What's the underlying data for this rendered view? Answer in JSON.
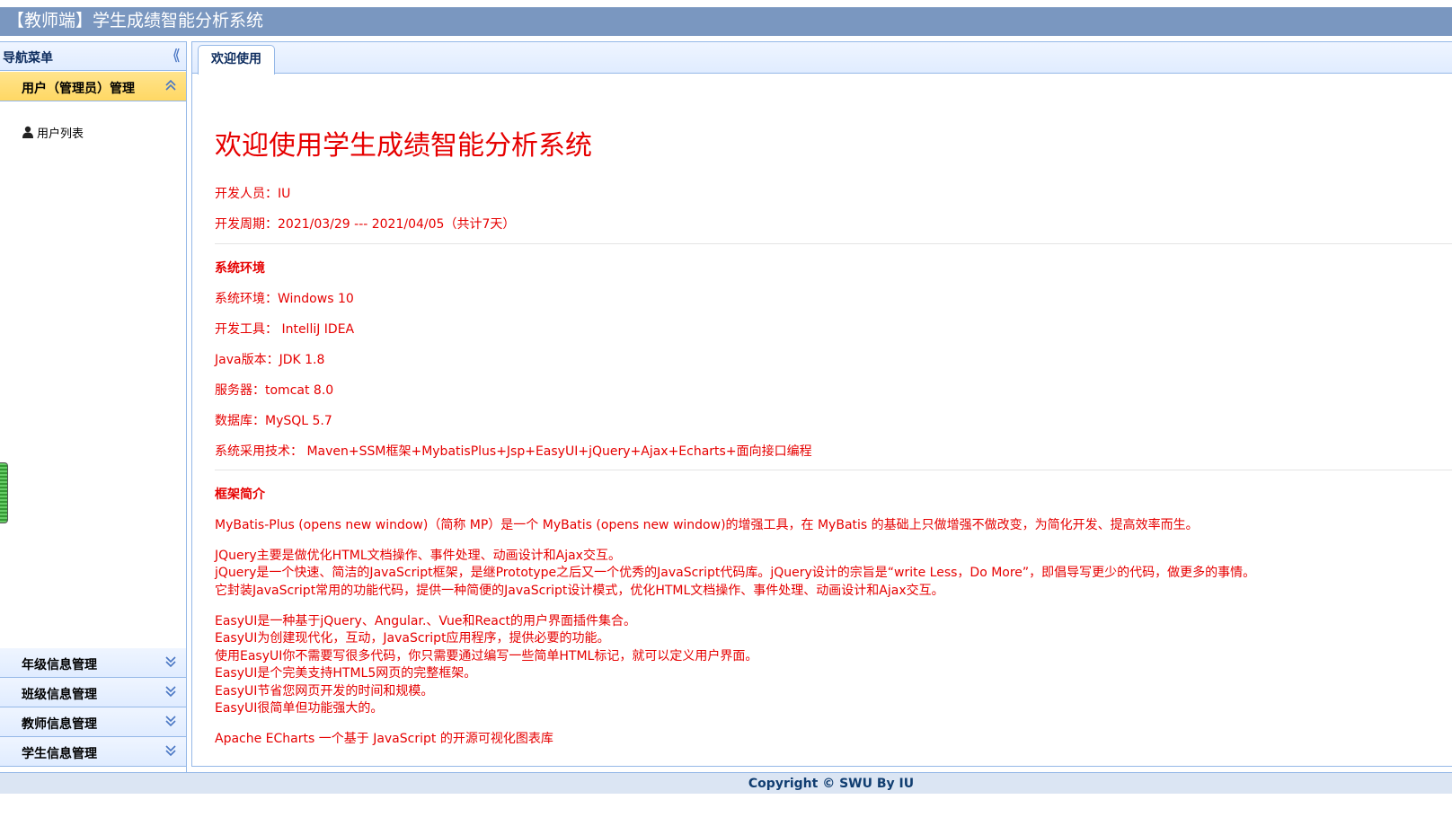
{
  "header": {
    "title": "【教师端】学生成绩智能分析系统"
  },
  "sidebar": {
    "title": "导航菜单",
    "collapse_icon": "double-chevron-left-icon",
    "active_section": {
      "label": "用户（管理员）管理",
      "items": [
        {
          "label": "用户列表",
          "icon": "user-icon"
        }
      ]
    },
    "sections": [
      {
        "label": "年级信息管理"
      },
      {
        "label": "班级信息管理"
      },
      {
        "label": "教师信息管理"
      },
      {
        "label": "学生信息管理"
      }
    ]
  },
  "tabs": [
    {
      "label": "欢迎使用"
    }
  ],
  "welcome": {
    "heading": "欢迎使用学生成绩智能分析系统",
    "developer": "开发人员：IU",
    "period": "开发周期：2021/03/29 --- 2021/04/05（共计7天）",
    "env_title": "系统环境",
    "env": [
      "系统环境：Windows 10",
      "开发工具： IntelliJ IDEA",
      "Java版本：JDK 1.8",
      "服务器：tomcat 8.0",
      "数据库：MySQL 5.7",
      "系统采用技术： Maven+SSM框架+MybatisPlus+Jsp+EasyUI+jQuery+Ajax+Echarts+面向接口编程"
    ],
    "fw_title": "框架简介",
    "mybatis": "MyBatis-Plus (opens new window)（简称 MP）是一个 MyBatis (opens new window)的增强工具，在 MyBatis 的基础上只做增强不做改变，为简化开发、提高效率而生。",
    "jquery": [
      "JQuery主要是做优化HTML文档操作、事件处理、动画设计和Ajax交互。",
      "jQuery是一个快速、简洁的JavaScript框架，是继Prototype之后又一个优秀的JavaScript代码库。jQuery设计的宗旨是“write Less，Do More”，即倡导写更少的代码，做更多的事情。",
      "它封装JavaScript常用的功能代码，提供一种简便的JavaScript设计模式，优化HTML文档操作、事件处理、动画设计和Ajax交互。"
    ],
    "easyui": [
      "EasyUI是一种基于jQuery、Angular.、Vue和React的用户界面插件集合。",
      "EasyUI为创建现代化，互动，JavaScript应用程序，提供必要的功能。",
      "使用EasyUI你不需要写很多代码，你只需要通过编写一些简单HTML标记，就可以定义用户界面。",
      "EasyUI是个完美支持HTML5网页的完整框架。",
      "EasyUI节省您网页开发的时间和规模。",
      "EasyUI很简单但功能强大的。"
    ],
    "echarts": "Apache ECharts 一个基于 JavaScript 的开源可视化图表库"
  },
  "footer": {
    "copyright": "Copyright © SWU By IU"
  },
  "colors": {
    "header": "#7a97c0",
    "border": "#95b8e7",
    "text_red": "#e60000",
    "active_section": "#ffd864"
  }
}
